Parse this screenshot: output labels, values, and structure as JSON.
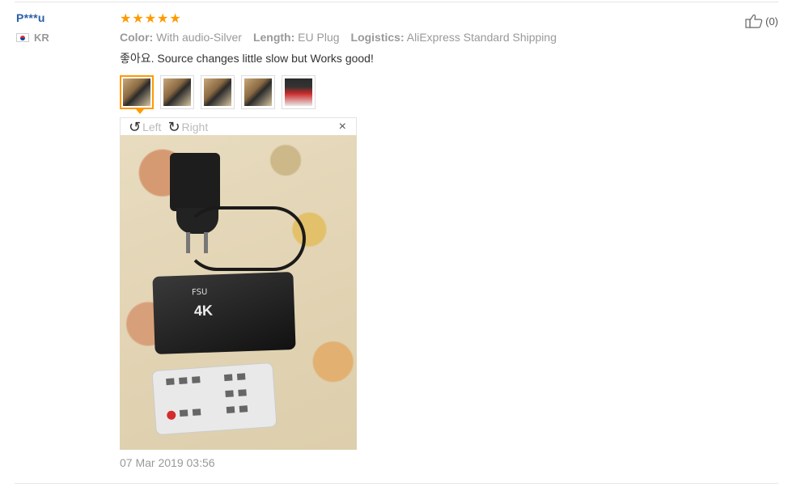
{
  "reviewer": {
    "name": "P***u",
    "country_code": "KR",
    "flag_icon": "korea-flag-icon"
  },
  "review": {
    "rating": 5,
    "stars": [
      "★",
      "★",
      "★",
      "★",
      "★"
    ],
    "attributes": [
      {
        "label": "Color:",
        "value": "With audio-Silver"
      },
      {
        "label": "Length:",
        "value": "EU Plug"
      },
      {
        "label": "Logistics:",
        "value": "AliExpress Standard Shipping"
      }
    ],
    "text": "좋아요. Source changes little slow but Works good!",
    "timestamp": "07 Mar 2019 03:56"
  },
  "gallery": {
    "thumbnail_count": 5,
    "active_index": 0
  },
  "viewer": {
    "rotate_left_label": "Left",
    "rotate_right_label": "Right",
    "rotate_left_icon": "↺",
    "rotate_right_icon": "↻",
    "close_icon": "×",
    "photo_box_brand": "FSU",
    "photo_box_text": "4K"
  },
  "helpful": {
    "count_label": "(0)",
    "icon": "thumbs-up-icon"
  },
  "colors": {
    "star": "#ff9a00",
    "username": "#2d5fa8",
    "muted": "#999999",
    "active_border": "#ff9a00"
  }
}
